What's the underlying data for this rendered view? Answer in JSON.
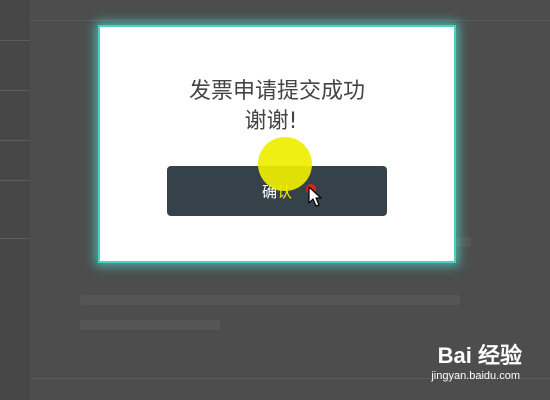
{
  "dialog": {
    "message_line1": "发票申请提交成功",
    "message_line2": "谢谢!",
    "confirm_label_part1": "确",
    "confirm_label_part2": "认"
  },
  "watermark": {
    "logo_text": "Bai 经验",
    "url": "jingyan.baidu.com"
  },
  "colors": {
    "modal_border": "#4dd0c1",
    "button_bg": "#36424a",
    "click_indicator": "#eeee00",
    "overlay": "#4a4a4a"
  }
}
